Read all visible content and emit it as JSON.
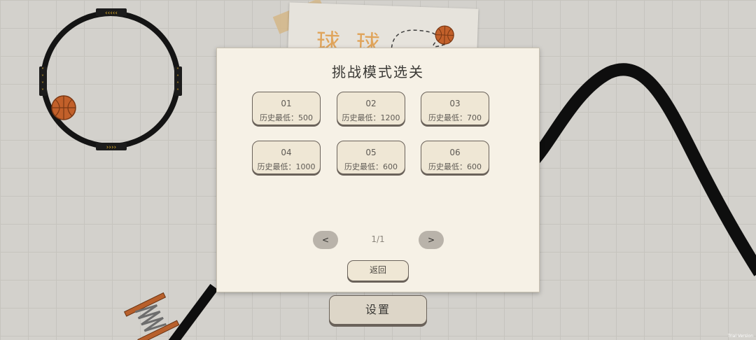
{
  "background": {
    "paper_title": "球 球"
  },
  "dialog": {
    "title": "挑战模式选关",
    "levels": [
      {
        "number": "01",
        "score": "历史最低：500"
      },
      {
        "number": "02",
        "score": "历史最低：1200"
      },
      {
        "number": "03",
        "score": "历史最低：700"
      },
      {
        "number": "04",
        "score": "历史最低：1000"
      },
      {
        "number": "05",
        "score": "历史最低：600"
      },
      {
        "number": "06",
        "score": "历史最低：600"
      }
    ],
    "pagination": {
      "prev_label": "<",
      "next_label": ">",
      "page_text": "1/1"
    },
    "back_label": "返回"
  },
  "settings_label": "设置",
  "watermark": "Trial Version",
  "colors": {
    "track": "#141414",
    "ball": "#c2602a",
    "chevron": "#e2b02a",
    "dialog_bg": "#f6f1e6",
    "button_bg": "#efe7d5"
  }
}
